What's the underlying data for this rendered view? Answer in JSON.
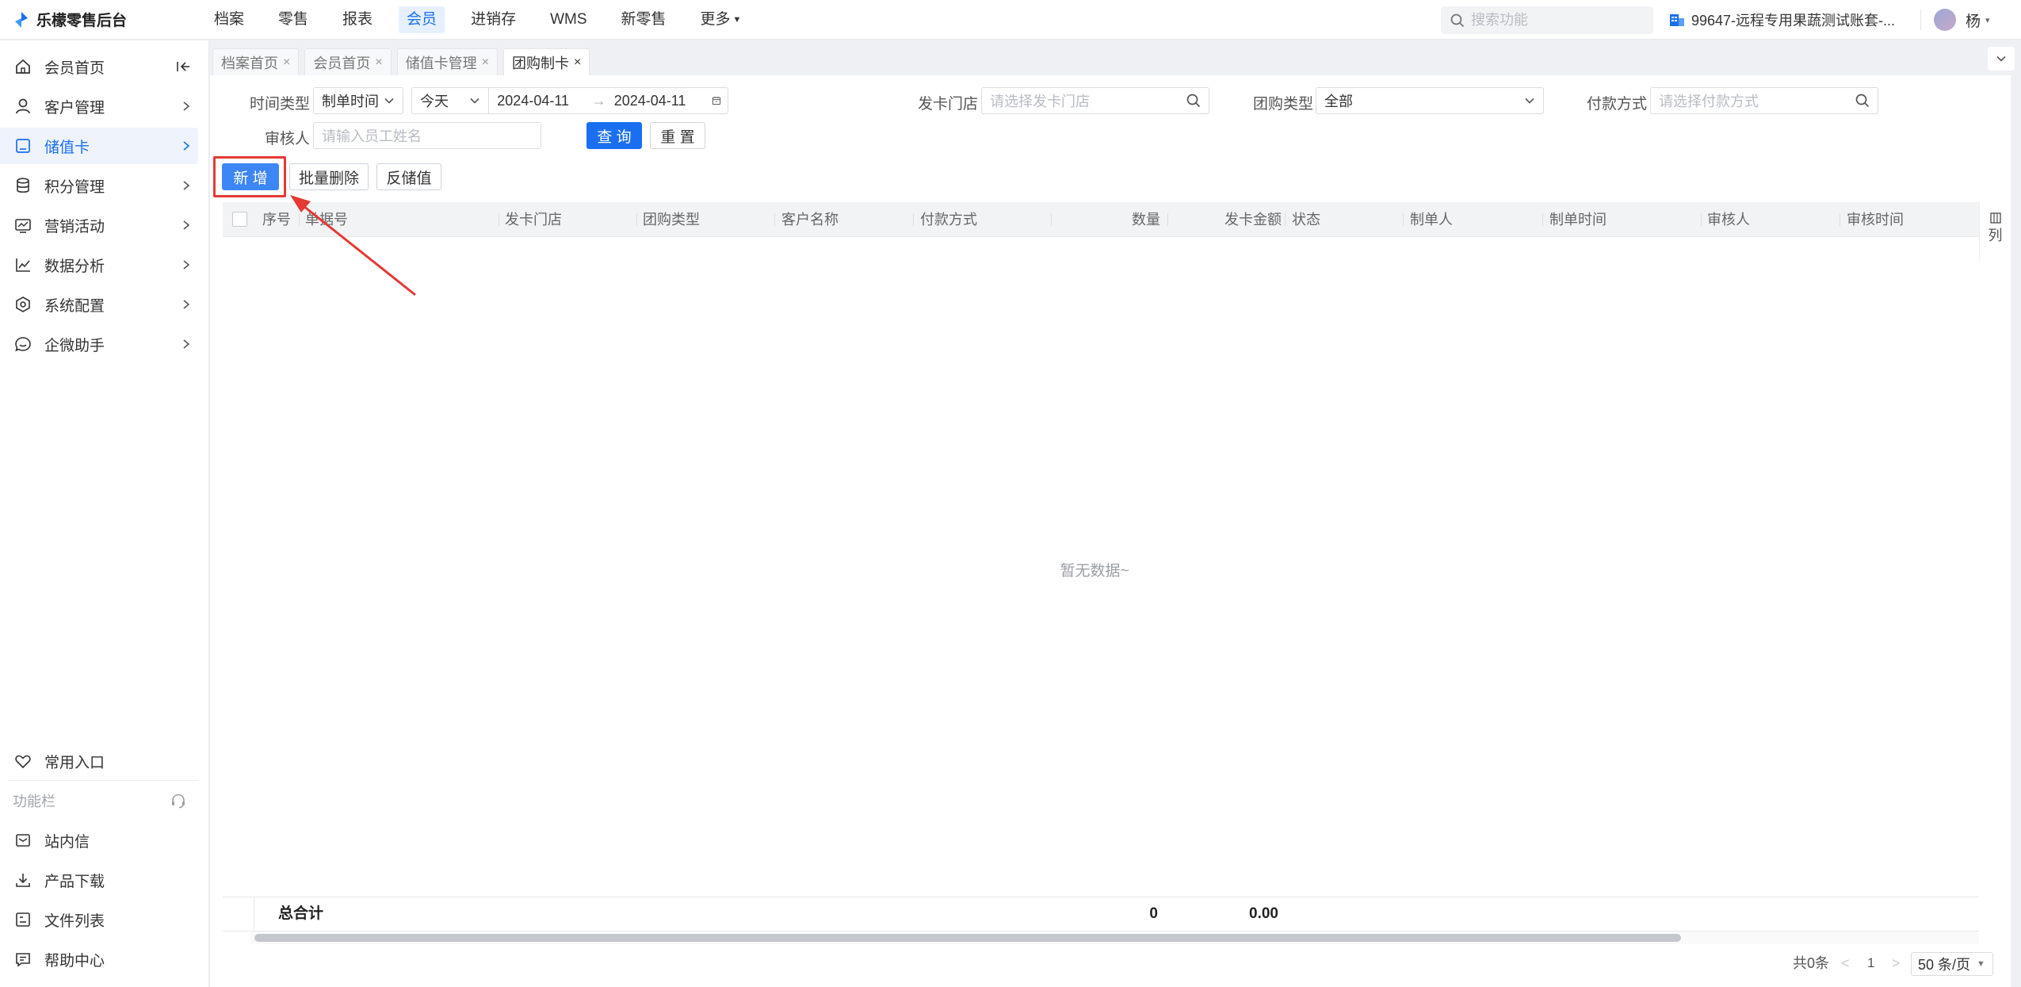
{
  "app": {
    "title": "乐檬零售后台"
  },
  "topnav": {
    "items": [
      "档案",
      "零售",
      "报表",
      "会员",
      "进销存",
      "WMS",
      "新零售",
      "更多"
    ],
    "active_index": 3
  },
  "search": {
    "placeholder": "搜索功能"
  },
  "account": {
    "name": "99647-远程专用果蔬测试账套-..."
  },
  "user": {
    "name": "杨"
  },
  "sidebar": {
    "items": [
      {
        "label": "会员首页",
        "icon": "home-icon"
      },
      {
        "label": "客户管理",
        "icon": "user-icon"
      },
      {
        "label": "储值卡",
        "icon": "card-icon"
      },
      {
        "label": "积分管理",
        "icon": "database-icon"
      },
      {
        "label": "营销活动",
        "icon": "campaign-icon"
      },
      {
        "label": "数据分析",
        "icon": "chart-icon"
      },
      {
        "label": "系统配置",
        "icon": "settings-icon"
      },
      {
        "label": "企微助手",
        "icon": "chat-icon"
      }
    ],
    "active_index": 2,
    "favorites": "常用入口",
    "section_title": "功能栏",
    "bottom_items": [
      {
        "label": "站内信",
        "icon": "mail-icon"
      },
      {
        "label": "产品下载",
        "icon": "download-icon"
      },
      {
        "label": "文件列表",
        "icon": "file-list-icon"
      },
      {
        "label": "帮助中心",
        "icon": "help-icon"
      }
    ]
  },
  "tabs": [
    {
      "label": "档案首页"
    },
    {
      "label": "会员首页"
    },
    {
      "label": "储值卡管理"
    },
    {
      "label": "团购制卡"
    }
  ],
  "filters": {
    "time_type_label": "时间类型",
    "time_type_value": "制单时间",
    "date_range_value": "今天",
    "date_start": "2024-04-11",
    "date_end": "2024-04-11",
    "store_label": "发卡门店",
    "store_placeholder": "请选择发卡门店",
    "group_type_label": "团购类型",
    "group_type_value": "全部",
    "payment_label": "付款方式",
    "payment_placeholder": "请选择付款方式",
    "auditor_label": "审核人",
    "auditor_placeholder": "请输入员工姓名",
    "query": "查 询",
    "reset": "重 置"
  },
  "actions": {
    "add": "新 增",
    "batch_delete": "批量删除",
    "reverse": "反储值"
  },
  "table": {
    "columns": [
      "序号",
      "单据号",
      "发卡门店",
      "团购类型",
      "客户名称",
      "付款方式",
      "数量",
      "发卡金额",
      "状态",
      "制单人",
      "制单时间",
      "审核人",
      "审核时间"
    ],
    "column_setting": "列",
    "empty_text": "暂无数据~",
    "total_label": "总合计",
    "total_qty": "0",
    "total_amount": "0.00"
  },
  "pagination": {
    "total_text": "共0条",
    "prev": "<",
    "page": "1",
    "next": ">",
    "page_size": "50 条/页"
  },
  "colors": {
    "accent": "#1a6ff0",
    "annotation": "#e53935"
  }
}
